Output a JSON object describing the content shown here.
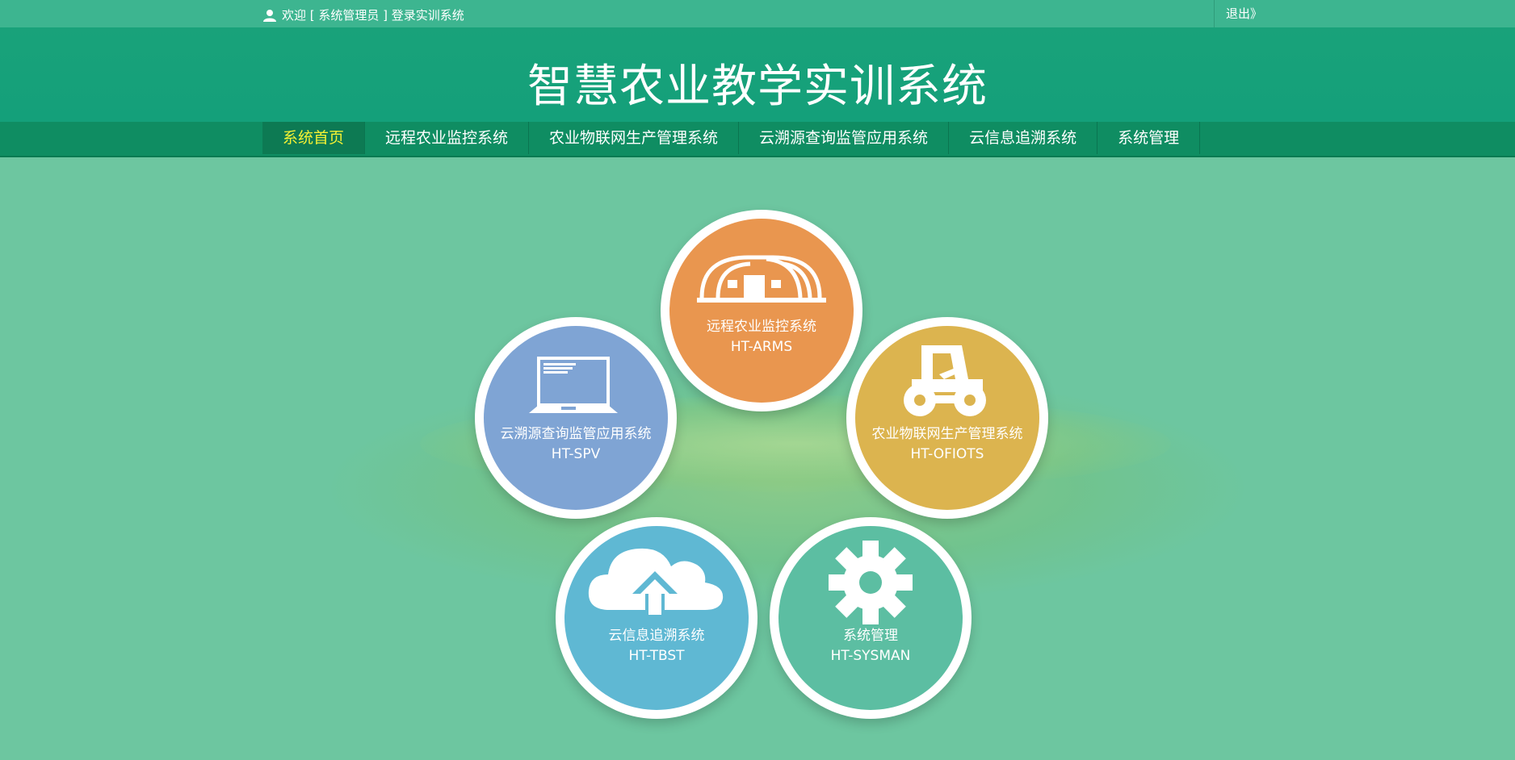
{
  "topbar": {
    "welcome": "欢迎 [ 系统管理员 ] 登录实训系统",
    "logout": "退出》"
  },
  "header": {
    "title": "智慧农业教学实训系统"
  },
  "nav": [
    "系统首页",
    "远程农业监控系统",
    "农业物联网生产管理系统",
    "云溯源查询监管应用系统",
    "云信息追溯系统",
    "系统管理"
  ],
  "modules": {
    "arms": {
      "name": "远程农业监控系统",
      "code": "HT-ARMS",
      "color": "#e9964f",
      "icon": "greenhouse-icon"
    },
    "spv": {
      "name": "云溯源查询监管应用系统",
      "code": "HT-SPV",
      "color": "#7fa4d4",
      "icon": "laptop-icon"
    },
    "ofiots": {
      "name": "农业物联网生产管理系统",
      "code": "HT-OFIOTS",
      "color": "#dcb44f",
      "icon": "tractor-icon"
    },
    "tbst": {
      "name": "云信息追溯系统",
      "code": "HT-TBST",
      "color": "#5fb8d3",
      "icon": "cloud-upload-icon"
    },
    "sysman": {
      "name": "系统管理",
      "code": "HT-SYSMAN",
      "color": "#5cbea2",
      "icon": "gear-icon"
    }
  },
  "colors": {
    "background": "#6dc6a0",
    "header": "#14a07a",
    "nav": "#0f8d62",
    "nav_active_text": "#f5f233"
  }
}
